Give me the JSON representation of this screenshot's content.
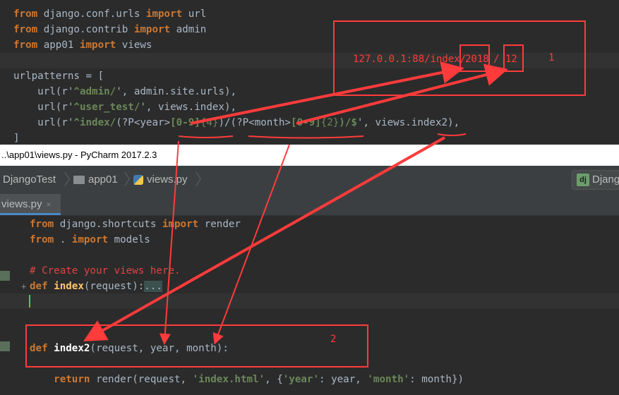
{
  "top_code": {
    "import1": {
      "from": "from",
      "mod": " django.conf.urls ",
      "imp": "import",
      "name": " url"
    },
    "import2": {
      "from": "from",
      "mod": " django.contrib ",
      "imp": "import",
      "name": " admin"
    },
    "import3": {
      "from": "from",
      "mod": " app01 ",
      "imp": "import",
      "name": " views"
    },
    "urlpatterns": "urlpatterns = [",
    "url1": {
      "pre": "    url(r'",
      "re": "^admin/",
      "post": "', admin.site.urls),"
    },
    "url2": {
      "pre": "    url(r'",
      "re": "^user_test/",
      "post": "', views.index),"
    },
    "url3": {
      "pre": "    url(r'",
      "re": "^index/",
      "g1a": "(?P<year>",
      "g1b": "[0-9]",
      "g1c": "{4}",
      "g1d": ")/",
      "g2a": "(?P<month>",
      "g2b": "[0-9]",
      "g2c": "{2}",
      "g2d": ")/$",
      "post": "', views.index2),"
    },
    "close": "]"
  },
  "annotation": {
    "url_prefix": "127.0.0.1:88/index/",
    "year": "2018",
    "sep": "/",
    "month": "12",
    "label1": "1",
    "label2": "2"
  },
  "window": {
    "title": "..\\app01\\views.py - PyCharm 2017.2.3"
  },
  "breadcrumbs": [
    "DjangoTest",
    "app01",
    "views.py"
  ],
  "run_config": "Djang",
  "tab": {
    "label": "views.py",
    "close": "×"
  },
  "bottom_code": {
    "l1": {
      "from": "from",
      "mod": " django.shortcuts ",
      "imp": "import",
      "name": " render"
    },
    "l2": {
      "from": "from",
      "mod": " . ",
      "imp": "import",
      "name": " models"
    },
    "comment": "# Create your views here.",
    "def1": {
      "kw": "def",
      "name": " index",
      "args": "(request):",
      "fold": "..."
    },
    "def2": {
      "kw": "def",
      "name": " index2",
      "args": "(request, year, month):"
    },
    "ret": {
      "kw": "return",
      "call": " render(request, ",
      "s1": "'index.html'",
      "mid": ", {",
      "s2": "'year'",
      "mid2": ": year, ",
      "s3": "'month'",
      "mid3": ": month})"
    }
  }
}
